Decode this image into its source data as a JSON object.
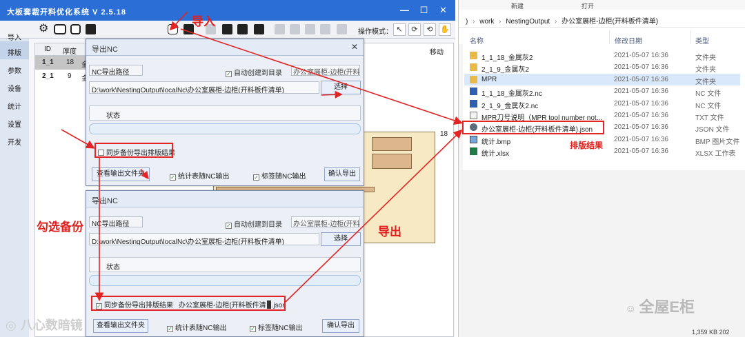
{
  "app": {
    "title": "大板套裁开料优化系统 V 2.5.18",
    "op_mode_label": "操作模式：",
    "sidebar": [
      "导入",
      "排版",
      "参数",
      "设备",
      "统计",
      "设置",
      "开发"
    ],
    "grid_headers": [
      "ID",
      "厚度"
    ],
    "grid_rows": [
      {
        "id": "1_1",
        "thickness": "18",
        "material": "金"
      },
      {
        "id": "2_1",
        "thickness": "9",
        "material": "金"
      }
    ],
    "move_label": "移动",
    "dim_label": "18"
  },
  "dialog_top": {
    "title": "导出NC",
    "path_label": "NC导出路径",
    "auto_create": "自动创建到目录",
    "folder_name": "办公室展柜-边柜(开料板",
    "path_value": "D:\\work\\NestingOutput\\localNc\\办公室展柜-边柜(开料板件清单)",
    "choose_btn": "选择",
    "status_label": "状态",
    "backup_label": "同步备份导出排版结果",
    "view_folder_btn": "查看输出文件夹",
    "stats_cb": "统计表随NC输出",
    "label_cb": "标签随NC输出",
    "confirm_btn": "确认导出"
  },
  "dialog_bottom": {
    "title": "导出NC",
    "path_label": "NC导出路径",
    "auto_create": "自动创建到目录",
    "folder_name": "办公室展柜-边柜(开料板",
    "path_value": "D:\\work\\NestingOutput\\localNc\\办公室展柜-边柜(开料板件清单)",
    "choose_btn": "选择",
    "status_label": "状态",
    "backup_label": "同步备份导出排版结果",
    "backup_filename": "办公室展柜-边柜(开料板件清",
    "backup_ext": ".json",
    "view_folder_btn": "查看输出文件夹",
    "stats_cb": "统计表随NC输出",
    "label_cb": "标签随NC输出",
    "confirm_btn": "确认导出"
  },
  "explorer": {
    "ribbon": {
      "new": "新建",
      "open": "打开"
    },
    "breadcrumb": [
      ")",
      "work",
      "NestingOutput",
      "办公室展柜-边柜(开料板件清单)"
    ],
    "columns": {
      "name": "名称",
      "date": "修改日期",
      "type": "类型"
    },
    "files": [
      {
        "name": "1_1_18_金属灰2",
        "date": "2021-05-07 16:36",
        "type": "文件夹",
        "icon": "folder-icon"
      },
      {
        "name": "2_1_9_金属灰2",
        "date": "2021-05-07 16:36",
        "type": "文件夹",
        "icon": "folder-icon"
      },
      {
        "name": "MPR",
        "date": "2021-05-07 16:36",
        "type": "文件夹",
        "icon": "folder-icon"
      },
      {
        "name": "1_1_18_金属灰2.nc",
        "date": "2021-05-07 16:36",
        "type": "NC 文件",
        "icon": "nc-file-icon"
      },
      {
        "name": "2_1_9_金属灰2.nc",
        "date": "2021-05-07 16:36",
        "type": "NC 文件",
        "icon": "nc-file-icon"
      },
      {
        "name": "MPR刀号说明（MPR tool number not...",
        "date": "2021-05-07 16:36",
        "type": "TXT 文件",
        "icon": "txt-file-icon"
      },
      {
        "name": "办公室展柜-边柜(开料板件清单).json",
        "date": "2021-05-07 16:36",
        "type": "JSON 文件",
        "icon": "json-file-icon"
      },
      {
        "name": "统计.bmp",
        "date": "2021-05-07 16:36",
        "type": "BMP 图片文件",
        "icon": "bmp-file-icon"
      },
      {
        "name": "统计.xlsx",
        "date": "2021-05-07 16:36",
        "type": "XLSX 工作表",
        "icon": "xlsx-file-icon"
      }
    ],
    "status_snippet": "1,359 KB  202"
  },
  "annotations": {
    "import": "导入",
    "check_backup": "勾选备份",
    "export": "导出",
    "layout_result": "排版结果"
  },
  "watermarks": {
    "right": "全屋E柜",
    "left": "八心数暗镜"
  },
  "colors": {
    "titlebar": "#2b6fd6",
    "annotation": "#e22424",
    "selection": "#d9e9fb"
  }
}
